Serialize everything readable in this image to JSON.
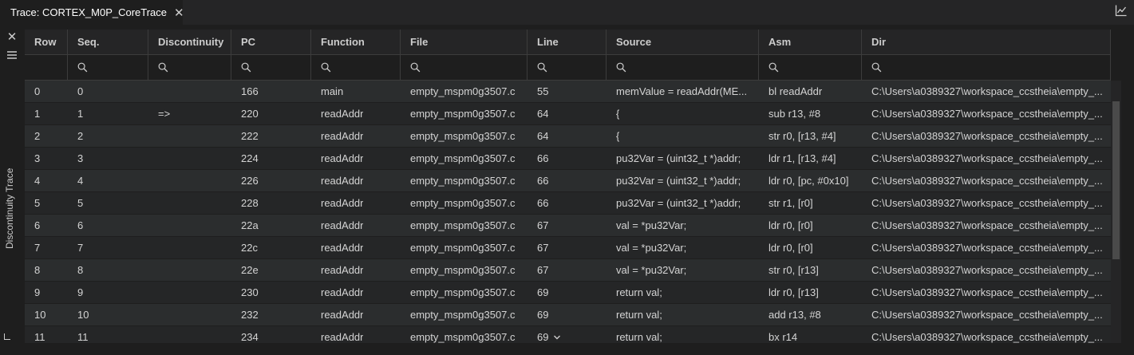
{
  "tab": {
    "title": "Trace: CORTEX_M0P_CoreTrace",
    "close": "✕"
  },
  "side": {
    "close": "✕",
    "label": "Discontinuity Trace"
  },
  "columns": [
    "Row",
    "Seq.",
    "Discontinuity",
    "PC",
    "Function",
    "File",
    "Line",
    "Source",
    "Asm",
    "Dir"
  ],
  "rows": [
    [
      "0",
      "0",
      "",
      "166",
      "main",
      "empty_mspm0g3507.c",
      "55",
      "memValue = readAddr(ME...",
      "bl readAddr",
      "C:\\Users\\a0389327\\workspace_ccstheia\\empty_..."
    ],
    [
      "1",
      "1",
      "=>",
      "220",
      "readAddr",
      "empty_mspm0g3507.c",
      "64",
      "{",
      "sub r13, #8",
      "C:\\Users\\a0389327\\workspace_ccstheia\\empty_..."
    ],
    [
      "2",
      "2",
      "",
      "222",
      "readAddr",
      "empty_mspm0g3507.c",
      "64",
      "{",
      "str r0, [r13, #4]",
      "C:\\Users\\a0389327\\workspace_ccstheia\\empty_..."
    ],
    [
      "3",
      "3",
      "",
      "224",
      "readAddr",
      "empty_mspm0g3507.c",
      "66",
      "pu32Var = (uint32_t *)addr;",
      "ldr r1, [r13, #4]",
      "C:\\Users\\a0389327\\workspace_ccstheia\\empty_..."
    ],
    [
      "4",
      "4",
      "",
      "226",
      "readAddr",
      "empty_mspm0g3507.c",
      "66",
      "pu32Var = (uint32_t *)addr;",
      "ldr r0, [pc, #0x10]",
      "C:\\Users\\a0389327\\workspace_ccstheia\\empty_..."
    ],
    [
      "5",
      "5",
      "",
      "228",
      "readAddr",
      "empty_mspm0g3507.c",
      "66",
      "pu32Var = (uint32_t *)addr;",
      "str r1, [r0]",
      "C:\\Users\\a0389327\\workspace_ccstheia\\empty_..."
    ],
    [
      "6",
      "6",
      "",
      "22a",
      "readAddr",
      "empty_mspm0g3507.c",
      "67",
      "val = *pu32Var;",
      "ldr r0, [r0]",
      "C:\\Users\\a0389327\\workspace_ccstheia\\empty_..."
    ],
    [
      "7",
      "7",
      "",
      "22c",
      "readAddr",
      "empty_mspm0g3507.c",
      "67",
      "val = *pu32Var;",
      "ldr r0, [r0]",
      "C:\\Users\\a0389327\\workspace_ccstheia\\empty_..."
    ],
    [
      "8",
      "8",
      "",
      "22e",
      "readAddr",
      "empty_mspm0g3507.c",
      "67",
      "val = *pu32Var;",
      "str r0, [r13]",
      "C:\\Users\\a0389327\\workspace_ccstheia\\empty_..."
    ],
    [
      "9",
      "9",
      "",
      "230",
      "readAddr",
      "empty_mspm0g3507.c",
      "69",
      "return val;",
      "ldr r0, [r13]",
      "C:\\Users\\a0389327\\workspace_ccstheia\\empty_..."
    ],
    [
      "10",
      "10",
      "",
      "232",
      "readAddr",
      "empty_mspm0g3507.c",
      "69",
      "return val;",
      "add r13, #8",
      "C:\\Users\\a0389327\\workspace_ccstheia\\empty_..."
    ],
    [
      "11",
      "11",
      "",
      "234",
      "readAddr",
      "empty_mspm0g3507.c",
      "69",
      "return val;",
      "bx r14",
      "C:\\Users\\a0389327\\workspace_ccstheia\\empty_..."
    ]
  ],
  "icons": {
    "tab": "line-chart-icon",
    "corner": "line-chart-icon",
    "menu": "hamburger-menu-icon",
    "filter": "search-icon",
    "chevron": "chevron-down-icon"
  }
}
